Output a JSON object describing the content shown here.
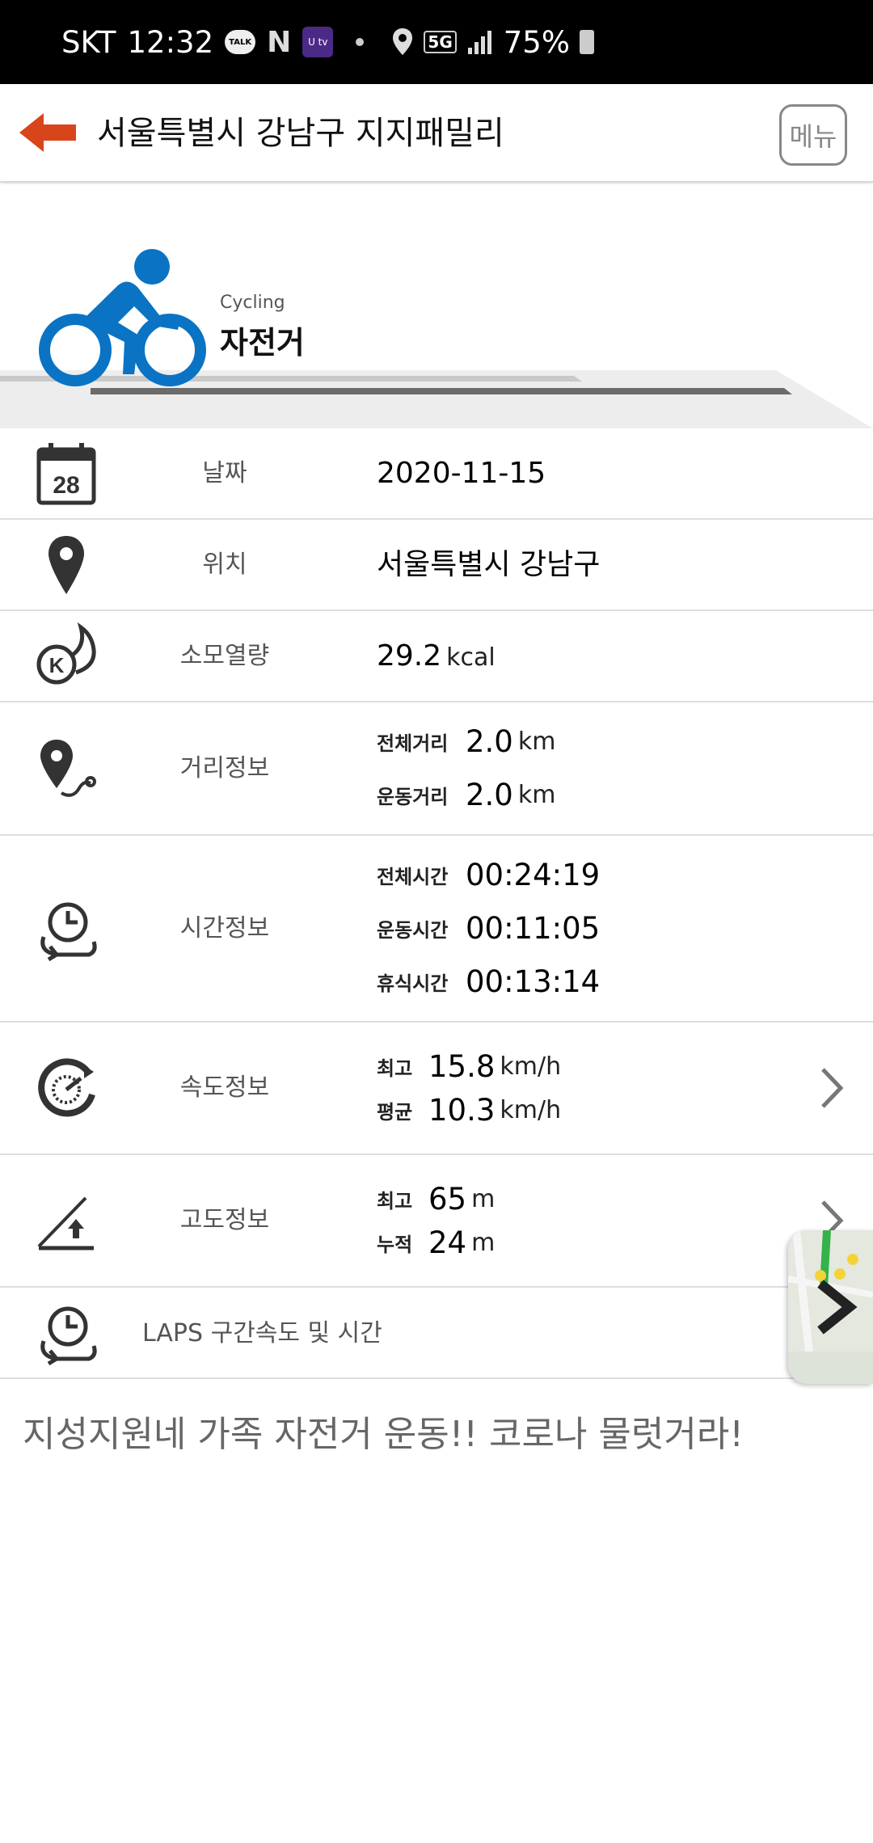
{
  "status_bar": {
    "carrier": "SKT",
    "time": "12:32",
    "talk_icon_text": "TALK",
    "n_icon_text": "N",
    "utv_icon_text": "U tv",
    "network": "5G",
    "battery": "75%"
  },
  "header": {
    "title": "서울특별시 강남구 지지패밀리",
    "menu_label": "메뉴",
    "accent_color": "#d9451a"
  },
  "activity": {
    "type_en": "Cycling",
    "type_ko": "자전거",
    "icon_color": "#0a73c4"
  },
  "rows": {
    "date": {
      "label": "날짜",
      "icon_day": "28",
      "value": "2020-11-15"
    },
    "location": {
      "label": "위치",
      "value": "서울특별시 강남구"
    },
    "calories": {
      "label": "소모열량",
      "value": "29.2",
      "unit": "kcal",
      "icon_letter": "K"
    },
    "distance": {
      "label": "거리정보",
      "total_label": "전체거리",
      "total_value": "2.0",
      "total_unit": "km",
      "exercise_label": "운동거리",
      "exercise_value": "2.0",
      "exercise_unit": "km"
    },
    "time": {
      "label": "시간정보",
      "total_label": "전체시간",
      "total_value": "00:24:19",
      "exercise_label": "운동시간",
      "exercise_value": "00:11:05",
      "rest_label": "휴식시간",
      "rest_value": "00:13:14"
    },
    "speed": {
      "label": "속도정보",
      "max_label": "최고",
      "max_value": "15.8",
      "max_unit": "km/h",
      "avg_label": "평균",
      "avg_value": "10.3",
      "avg_unit": "km/h"
    },
    "altitude": {
      "label": "고도정보",
      "max_label": "최고",
      "max_value": "65",
      "max_unit": "m",
      "cum_label": "누적",
      "cum_value": "24",
      "cum_unit": "m"
    },
    "laps": {
      "label": "LAPS 구간속도 및 시간"
    }
  },
  "memo": "지성지원네 가족 자전거 운동!! 코로나 물럿거라!"
}
